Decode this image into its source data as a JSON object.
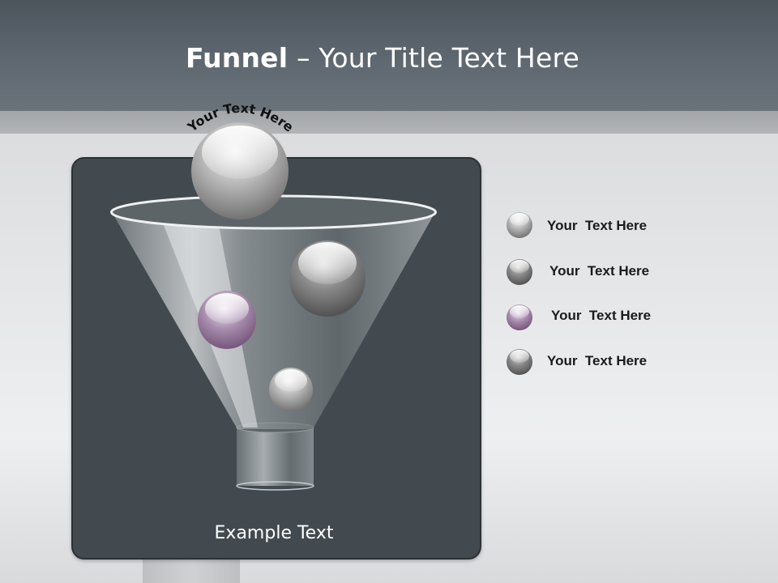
{
  "slide": {
    "title_bold": "Funnel",
    "title_rest": " – Your Title Text Here"
  },
  "diagram": {
    "arc_text": "Your Text Here",
    "example_text": "Example Text",
    "legend": [
      {
        "label": "Your  Text Here",
        "ball": "gray"
      },
      {
        "label": "Your  Text Here",
        "ball": "dark-gray"
      },
      {
        "label": "Your  Text Here",
        "ball": "purple"
      },
      {
        "label": "Your  Text Here",
        "ball": "dark-gray"
      }
    ]
  },
  "colors": {
    "header": "#5f6870",
    "panel": "#424a4f",
    "accent_purple": "#8a6a8e"
  }
}
